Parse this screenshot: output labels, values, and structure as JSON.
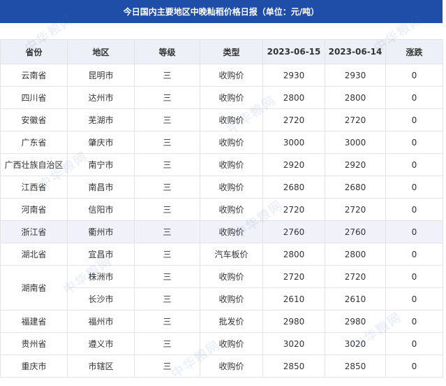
{
  "title": "今日国内主要地区中晚籼稻价格日报（单位：元/吨）",
  "columns": [
    "省份",
    "地区",
    "等级",
    "类型",
    "2023-06-15",
    "2023-06-14",
    "涨跌"
  ],
  "rows": [
    {
      "province": "云南省",
      "region": "昆明市",
      "grade": "三",
      "type": "收购价",
      "d1": "2930",
      "d2": "2930",
      "change": "0"
    },
    {
      "province": "四川省",
      "region": "达州市",
      "grade": "三",
      "type": "收购价",
      "d1": "2800",
      "d2": "2800",
      "change": "0"
    },
    {
      "province": "安徽省",
      "region": "芜湖市",
      "grade": "三",
      "type": "收购价",
      "d1": "2720",
      "d2": "2720",
      "change": "0"
    },
    {
      "province": "广东省",
      "region": "肇庆市",
      "grade": "三",
      "type": "收购价",
      "d1": "3000",
      "d2": "3000",
      "change": "0"
    },
    {
      "province": "广西壮族自治区",
      "region": "南宁市",
      "grade": "三",
      "type": "收购价",
      "d1": "2920",
      "d2": "2920",
      "change": "0"
    },
    {
      "province": "江西省",
      "region": "南昌市",
      "grade": "三",
      "type": "收购价",
      "d1": "2680",
      "d2": "2680",
      "change": "0"
    },
    {
      "province": "河南省",
      "region": "信阳市",
      "grade": "三",
      "type": "收购价",
      "d1": "2720",
      "d2": "2720",
      "change": "0"
    },
    {
      "province": "浙江省",
      "region": "衢州市",
      "grade": "三",
      "type": "收购价",
      "d1": "2760",
      "d2": "2760",
      "change": "0"
    },
    {
      "province": "湖北省",
      "region": "宜昌市",
      "grade": "三",
      "type": "汽车板价",
      "d1": "2800",
      "d2": "2800",
      "change": "0"
    },
    {
      "province": "湖南省",
      "region": "株洲市",
      "grade": "三",
      "type": "收购价",
      "d1": "2720",
      "d2": "2720",
      "change": "0"
    },
    {
      "province": "",
      "region": "长沙市",
      "grade": "三",
      "type": "收购价",
      "d1": "2610",
      "d2": "2610",
      "change": "0"
    },
    {
      "province": "福建省",
      "region": "福州市",
      "grade": "三",
      "type": "批发价",
      "d1": "2980",
      "d2": "2980",
      "change": "0"
    },
    {
      "province": "贵州省",
      "region": "遵义市",
      "grade": "三",
      "type": "收购价",
      "d1": "3020",
      "d2": "3020",
      "change": "0"
    },
    {
      "province": "重庆市",
      "region": "市辖区",
      "grade": "三",
      "type": "收购价",
      "d1": "2850",
      "d2": "2850",
      "change": "0"
    }
  ],
  "watermark": "中华粮网",
  "colors": {
    "banner": "#1f4ea8",
    "header_bg": "#eef0f7",
    "shaded_row": "#f0f1f9",
    "border": "#e3e3e3"
  }
}
